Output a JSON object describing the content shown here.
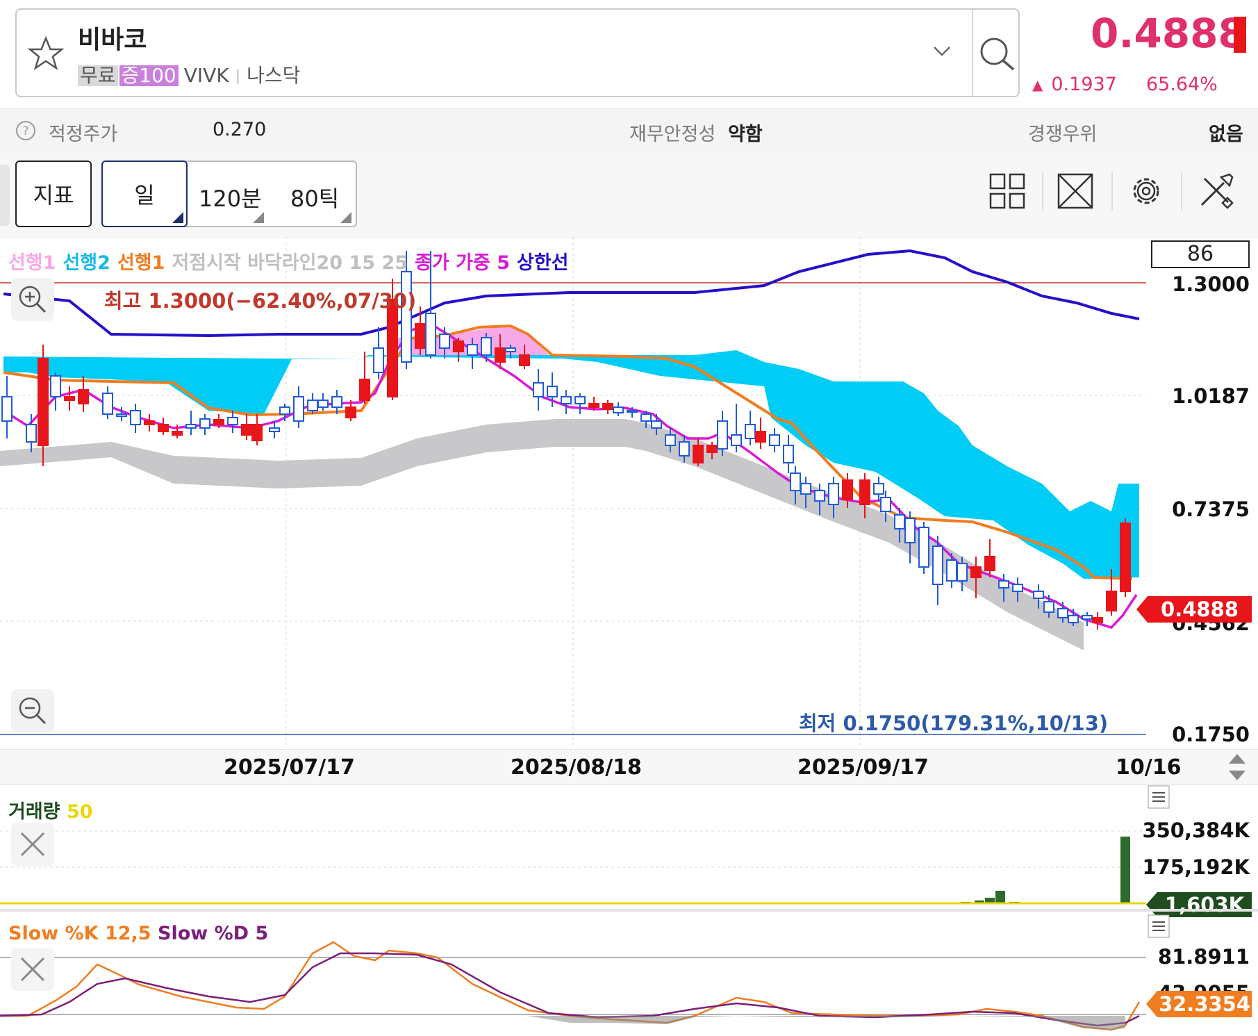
{
  "header": {
    "stock_name": "비바코",
    "tags": {
      "free": "무료",
      "margin": "증100",
      "ticker": "VIVK",
      "market": "나스닥"
    },
    "price": "0.4888",
    "change_arrow": "▲",
    "change": "0.1937",
    "change_pct": "65.64%"
  },
  "info_bar": {
    "fair_price_label": "적정주가",
    "fair_price_value": "0.270",
    "financial_label": "재무안정성",
    "financial_value": "약함",
    "competitive_label": "경쟁우위",
    "competitive_value": "없음"
  },
  "toolbar": {
    "indicator_label": "지표",
    "period_label": "일",
    "min_label": "120분",
    "tick_label": "80틱"
  },
  "legend": {
    "lead1": "선행1",
    "lead2": "선행2",
    "lead1b": "선행1",
    "bottom_start": "저점시작 바닥라인20 15 25",
    "wma": "종가 가중 5",
    "upper": "상한선"
  },
  "main_chart": {
    "axis_box": "86",
    "y_ticks": [
      "1.3000",
      "1.0187",
      "0.7375",
      "0.4562",
      "0.1750"
    ],
    "current_price_box": "0.4888",
    "high_label": "최고 1.3000(−62.40%,07/30)",
    "low_label": "최저 0.1750(179.31%,10/13)",
    "dates": [
      "2025/07/17",
      "2025/08/18",
      "2025/09/17",
      "10/16"
    ]
  },
  "volume_panel": {
    "title": "거래량",
    "ma": "50",
    "y_ticks": [
      "350,384K",
      "175,192K"
    ],
    "current_box": "1,603K"
  },
  "stoch_panel": {
    "title_k": "Slow %K 12,5",
    "title_d": "Slow %D 5",
    "y_ticks": [
      "81.8911",
      "43.9055"
    ],
    "current_box": "32.3354"
  },
  "colors": {
    "accent": "#e0306a",
    "rise": "#e8151b",
    "fall": "#1f5bd6",
    "cloud_blue": "#00ccf5",
    "cloud_pink": "#f8a9e8",
    "upper_line": "#2510c8",
    "orange_line": "#f07d20",
    "wma_line": "#d91ad9",
    "bottom_band": "#c8c7ca"
  },
  "chart_data": {
    "type": "candlestick",
    "x_dates": [
      "2025/07/17",
      "2025/08/18",
      "2025/09/17",
      "10/16"
    ],
    "ylim": [
      0.175,
      1.3
    ],
    "high": {
      "value": 1.3,
      "date": "07/30"
    },
    "low": {
      "value": 0.175,
      "date": "10/13"
    },
    "last": 0.4888
  }
}
